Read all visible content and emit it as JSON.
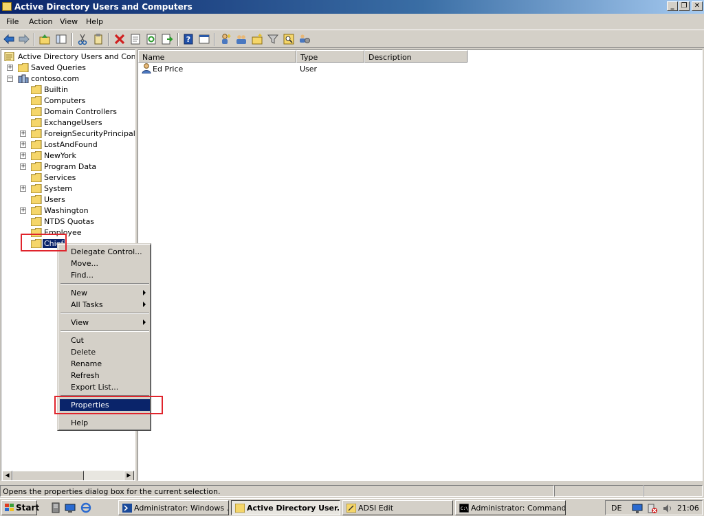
{
  "window": {
    "title": "Active Directory Users and Computers",
    "minimize_label": "_",
    "restore_label": "❐",
    "close_label": "✕"
  },
  "menu": [
    "File",
    "Action",
    "View",
    "Help"
  ],
  "toolbar": {
    "icons": [
      "back-icon",
      "forward-icon",
      "up-folder-icon",
      "show-hide-tree-icon",
      "cut-icon",
      "copy-icon",
      "delete-icon",
      "properties-icon",
      "refresh-icon",
      "export-list-icon",
      "help-icon",
      "console-tree-icon",
      "new-user-icon",
      "new-group-icon",
      "new-ou-icon",
      "filter-icon",
      "find-icon",
      "add-to-group-icon"
    ]
  },
  "tree": {
    "root": "Active Directory Users and Comput",
    "saved_queries": "Saved Queries",
    "domain": "contoso.com",
    "children": [
      {
        "label": "Builtin",
        "expandable": false
      },
      {
        "label": "Computers",
        "expandable": false
      },
      {
        "label": "Domain Controllers",
        "expandable": false
      },
      {
        "label": "ExchangeUsers",
        "expandable": false
      },
      {
        "label": "ForeignSecurityPrincipals",
        "expandable": true
      },
      {
        "label": "LostAndFound",
        "expandable": true
      },
      {
        "label": "NewYork",
        "expandable": true
      },
      {
        "label": "Program Data",
        "expandable": true
      },
      {
        "label": "Services",
        "expandable": false
      },
      {
        "label": "System",
        "expandable": true
      },
      {
        "label": "Users",
        "expandable": false
      },
      {
        "label": "Washington",
        "expandable": true
      },
      {
        "label": "NTDS Quotas",
        "expandable": false
      },
      {
        "label": "Employee",
        "expandable": false
      },
      {
        "label": "Chief",
        "expandable": false,
        "selected": true
      }
    ]
  },
  "list": {
    "columns": [
      "Name",
      "Type",
      "Description"
    ],
    "rows": [
      {
        "name": "Ed Price",
        "type": "User",
        "description": ""
      }
    ]
  },
  "context_menu": {
    "items": [
      {
        "label": "Delegate Control...",
        "submenu": false
      },
      {
        "label": "Move...",
        "submenu": false
      },
      {
        "label": "Find...",
        "submenu": false
      },
      {
        "separator": true
      },
      {
        "label": "New",
        "submenu": true
      },
      {
        "label": "All Tasks",
        "submenu": true
      },
      {
        "separator": true
      },
      {
        "label": "View",
        "submenu": true
      },
      {
        "separator": true
      },
      {
        "label": "Cut",
        "submenu": false
      },
      {
        "label": "Delete",
        "submenu": false
      },
      {
        "label": "Rename",
        "submenu": false
      },
      {
        "label": "Refresh",
        "submenu": false
      },
      {
        "label": "Export List...",
        "submenu": false
      },
      {
        "separator": true
      },
      {
        "label": "Properties",
        "submenu": false,
        "highlighted": true
      },
      {
        "separator": true
      },
      {
        "label": "Help",
        "submenu": false
      }
    ]
  },
  "statusbar": {
    "text": "Opens the properties dialog box for the current selection."
  },
  "taskbar": {
    "start_label": "Start",
    "buttons": [
      {
        "label": "Administrator: Windows ...",
        "active": false
      },
      {
        "label": "Active Directory User...",
        "active": true
      },
      {
        "label": "ADSI Edit",
        "active": false
      },
      {
        "label": "Administrator: Command...",
        "active": false
      }
    ],
    "language": "DE",
    "clock": "21:06"
  },
  "colors": {
    "selection": "#0a246a",
    "annotation_red": "#e0242c",
    "face": "#d4d0c8"
  }
}
